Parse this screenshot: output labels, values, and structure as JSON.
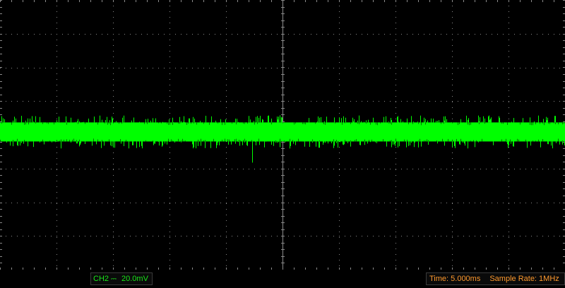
{
  "app": "Oscilloscope",
  "colors": {
    "background": "#000000",
    "grid": "#8a8a8a",
    "trace": "#00ff00",
    "channel_label": "#19e619",
    "time_label": "#ff9a2e"
  },
  "display": {
    "horizontal_divisions": 10,
    "vertical_divisions": 8,
    "trace": {
      "channel": "CH2",
      "type": "noise band",
      "center_fraction_from_top": 0.488
    }
  },
  "status": {
    "channel": "CH2",
    "coupling_symbol": "⎓",
    "volts_per_div": "20.0mV",
    "time_per_div": "Time: 5.000ms",
    "sample_rate": "Sample Rate: 1MHz"
  }
}
